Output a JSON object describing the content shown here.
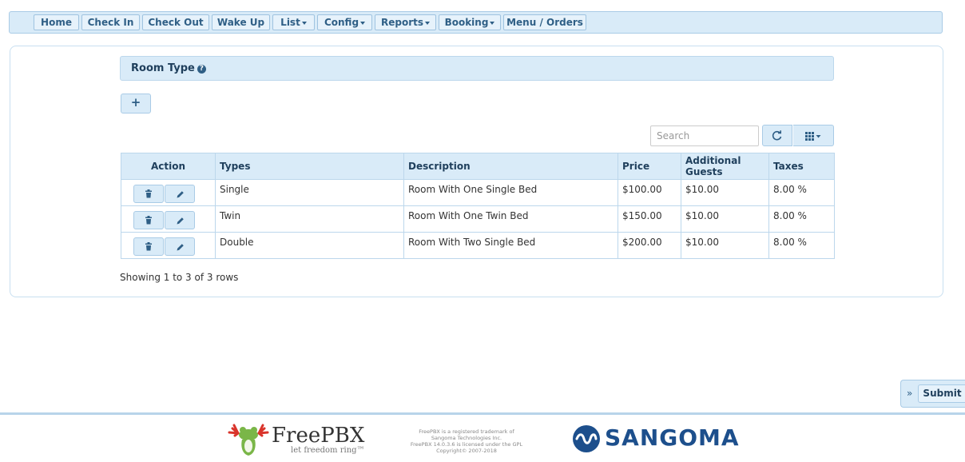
{
  "nav": {
    "items": [
      {
        "label": "Home",
        "caret": false
      },
      {
        "label": "Check In",
        "caret": false
      },
      {
        "label": "Check Out",
        "caret": false
      },
      {
        "label": "Wake Up",
        "caret": false
      },
      {
        "label": "List",
        "caret": true
      },
      {
        "label": "Config",
        "caret": true
      },
      {
        "label": "Reports",
        "caret": true
      },
      {
        "label": "Booking",
        "caret": true
      },
      {
        "label": "Menu / Orders",
        "caret": false
      }
    ]
  },
  "section": {
    "title": "Room Type"
  },
  "toolbar": {
    "add_label": "+",
    "search_placeholder": "Search"
  },
  "table": {
    "headers": {
      "action": "Action",
      "types": "Types",
      "description": "Description",
      "price": "Price",
      "additional_guests": "Additional Guests",
      "taxes": "Taxes"
    },
    "rows": [
      {
        "type": "Single",
        "description": "Room With One Single Bed",
        "price": "$100.00",
        "additional_guests": "$10.00",
        "taxes": "8.00 %"
      },
      {
        "type": "Twin",
        "description": "Room With One Twin Bed",
        "price": "$150.00",
        "additional_guests": "$10.00",
        "taxes": "8.00 %"
      },
      {
        "type": "Double",
        "description": "Room With Two Single Bed",
        "price": "$200.00",
        "additional_guests": "$10.00",
        "taxes": "8.00 %"
      }
    ]
  },
  "pagination": {
    "info": "Showing 1 to 3 of 3 rows"
  },
  "submit": {
    "chevron": "»",
    "label": "Submit"
  },
  "footer": {
    "freepbx_name": "FreePBX",
    "freepbx_tagline": "let freedom ring™",
    "legal_lines": [
      "FreePBX is a registered trademark of",
      "Sangoma Technologies Inc.",
      "FreePBX 14.0.3.6 is licensed under the GPL",
      "Copyright© 2007-2018"
    ],
    "sangoma_name": "SANGOMA"
  },
  "colors": {
    "accent": "#2f5f86",
    "header_bg": "#d9ebf8",
    "border": "#a9cbe6",
    "brand_blue": "#1d4f8c",
    "frog_green": "#7ab648",
    "frog_red": "#d9342b"
  }
}
